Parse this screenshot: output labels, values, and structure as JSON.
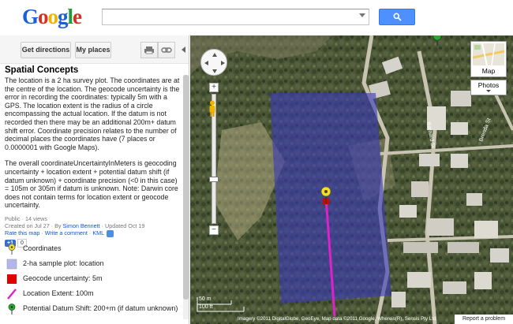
{
  "header": {
    "logo_letters": [
      "G",
      "o",
      "o",
      "g",
      "l",
      "e"
    ],
    "logo_colors": [
      "#1a5fd6",
      "#d2321f",
      "#f0b400",
      "#1a5fd6",
      "#1f9b3a",
      "#d2321f"
    ],
    "search_placeholder": ""
  },
  "toolbar": {
    "directions_label": "Get directions",
    "myplaces_label": "My places"
  },
  "panel": {
    "title": "Spatial Concepts",
    "paragraphs": [
      "The location is a 2 ha survey plot. The coordinates are at the centre of the location. The geocode uncertainty is the error in recording the coordinates: typically 5m with a GPS. The location extent is the radius of a circle encompassing the actual location. If the datum is not recorded then there may be an additional 200m+ datum shift error. Coordinate precision relates to the number of decimal places the coordinates have (7 places or 0.0000001 with Google Maps).",
      "The overall coordinateUncertaintyInMeters is geocoding uncertainty + location extent + potential datum shift (if datum unknown) + coordinate precision (<0 in this case) = 105m or 305m if datum is unknown. Note: Darwin core does not contain terms for location extent or geocode uncertainty."
    ],
    "meta_line1": "Public · 14 views",
    "meta_created_prefix": "Created on Jul 27 · By ",
    "meta_author": "Simon Bennett",
    "meta_updated": " · Updated Oct 19",
    "rate_link": "Rate this map",
    "comment_link": "Write a comment",
    "kml_link": "KML",
    "plus_one_label": "+1",
    "plus_one_count": "0"
  },
  "legend": [
    {
      "label": "Coordinates",
      "symbol": "yellow-pin-icon"
    },
    {
      "label": "2-ha sample plot: location",
      "symbol": "lavender-square-icon"
    },
    {
      "label": "Geocode uncertainty: 5m",
      "symbol": "red-square-icon"
    },
    {
      "label": "Location Extent: 100m",
      "symbol": "magenta-line-icon"
    },
    {
      "label": "Potential Datum Shift: 200+m (if datum unknown)",
      "symbol": "green-pin-icon"
    }
  ],
  "map": {
    "maptype_label": "Map",
    "photos_label": "Photos",
    "scale_m": "50 m",
    "scale_ft": "100 ft",
    "attribution": "Imagery ©2011 DigitalGlobe, GeoEye, Map data ©2011 Google, Whereis(R), Sensis Pty Ltd",
    "report_label": "Report a problem",
    "street_labels": [
      "Barnard St",
      "Brenda St"
    ],
    "plot_color": "#3a3ab8",
    "extent_line_color": "#e020c8"
  }
}
